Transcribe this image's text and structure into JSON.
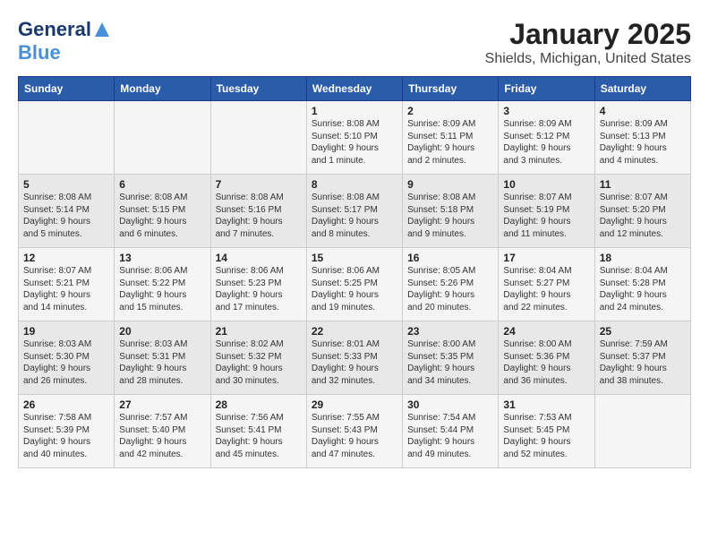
{
  "logo": {
    "general": "General",
    "blue": "Blue"
  },
  "title": "January 2025",
  "subtitle": "Shields, Michigan, United States",
  "weekdays": [
    "Sunday",
    "Monday",
    "Tuesday",
    "Wednesday",
    "Thursday",
    "Friday",
    "Saturday"
  ],
  "weeks": [
    [
      {
        "day": "",
        "info": ""
      },
      {
        "day": "",
        "info": ""
      },
      {
        "day": "",
        "info": ""
      },
      {
        "day": "1",
        "info": "Sunrise: 8:08 AM\nSunset: 5:10 PM\nDaylight: 9 hours\nand 1 minute."
      },
      {
        "day": "2",
        "info": "Sunrise: 8:09 AM\nSunset: 5:11 PM\nDaylight: 9 hours\nand 2 minutes."
      },
      {
        "day": "3",
        "info": "Sunrise: 8:09 AM\nSunset: 5:12 PM\nDaylight: 9 hours\nand 3 minutes."
      },
      {
        "day": "4",
        "info": "Sunrise: 8:09 AM\nSunset: 5:13 PM\nDaylight: 9 hours\nand 4 minutes."
      }
    ],
    [
      {
        "day": "5",
        "info": "Sunrise: 8:08 AM\nSunset: 5:14 PM\nDaylight: 9 hours\nand 5 minutes."
      },
      {
        "day": "6",
        "info": "Sunrise: 8:08 AM\nSunset: 5:15 PM\nDaylight: 9 hours\nand 6 minutes."
      },
      {
        "day": "7",
        "info": "Sunrise: 8:08 AM\nSunset: 5:16 PM\nDaylight: 9 hours\nand 7 minutes."
      },
      {
        "day": "8",
        "info": "Sunrise: 8:08 AM\nSunset: 5:17 PM\nDaylight: 9 hours\nand 8 minutes."
      },
      {
        "day": "9",
        "info": "Sunrise: 8:08 AM\nSunset: 5:18 PM\nDaylight: 9 hours\nand 9 minutes."
      },
      {
        "day": "10",
        "info": "Sunrise: 8:07 AM\nSunset: 5:19 PM\nDaylight: 9 hours\nand 11 minutes."
      },
      {
        "day": "11",
        "info": "Sunrise: 8:07 AM\nSunset: 5:20 PM\nDaylight: 9 hours\nand 12 minutes."
      }
    ],
    [
      {
        "day": "12",
        "info": "Sunrise: 8:07 AM\nSunset: 5:21 PM\nDaylight: 9 hours\nand 14 minutes."
      },
      {
        "day": "13",
        "info": "Sunrise: 8:06 AM\nSunset: 5:22 PM\nDaylight: 9 hours\nand 15 minutes."
      },
      {
        "day": "14",
        "info": "Sunrise: 8:06 AM\nSunset: 5:23 PM\nDaylight: 9 hours\nand 17 minutes."
      },
      {
        "day": "15",
        "info": "Sunrise: 8:06 AM\nSunset: 5:25 PM\nDaylight: 9 hours\nand 19 minutes."
      },
      {
        "day": "16",
        "info": "Sunrise: 8:05 AM\nSunset: 5:26 PM\nDaylight: 9 hours\nand 20 minutes."
      },
      {
        "day": "17",
        "info": "Sunrise: 8:04 AM\nSunset: 5:27 PM\nDaylight: 9 hours\nand 22 minutes."
      },
      {
        "day": "18",
        "info": "Sunrise: 8:04 AM\nSunset: 5:28 PM\nDaylight: 9 hours\nand 24 minutes."
      }
    ],
    [
      {
        "day": "19",
        "info": "Sunrise: 8:03 AM\nSunset: 5:30 PM\nDaylight: 9 hours\nand 26 minutes."
      },
      {
        "day": "20",
        "info": "Sunrise: 8:03 AM\nSunset: 5:31 PM\nDaylight: 9 hours\nand 28 minutes."
      },
      {
        "day": "21",
        "info": "Sunrise: 8:02 AM\nSunset: 5:32 PM\nDaylight: 9 hours\nand 30 minutes."
      },
      {
        "day": "22",
        "info": "Sunrise: 8:01 AM\nSunset: 5:33 PM\nDaylight: 9 hours\nand 32 minutes."
      },
      {
        "day": "23",
        "info": "Sunrise: 8:00 AM\nSunset: 5:35 PM\nDaylight: 9 hours\nand 34 minutes."
      },
      {
        "day": "24",
        "info": "Sunrise: 8:00 AM\nSunset: 5:36 PM\nDaylight: 9 hours\nand 36 minutes."
      },
      {
        "day": "25",
        "info": "Sunrise: 7:59 AM\nSunset: 5:37 PM\nDaylight: 9 hours\nand 38 minutes."
      }
    ],
    [
      {
        "day": "26",
        "info": "Sunrise: 7:58 AM\nSunset: 5:39 PM\nDaylight: 9 hours\nand 40 minutes."
      },
      {
        "day": "27",
        "info": "Sunrise: 7:57 AM\nSunset: 5:40 PM\nDaylight: 9 hours\nand 42 minutes."
      },
      {
        "day": "28",
        "info": "Sunrise: 7:56 AM\nSunset: 5:41 PM\nDaylight: 9 hours\nand 45 minutes."
      },
      {
        "day": "29",
        "info": "Sunrise: 7:55 AM\nSunset: 5:43 PM\nDaylight: 9 hours\nand 47 minutes."
      },
      {
        "day": "30",
        "info": "Sunrise: 7:54 AM\nSunset: 5:44 PM\nDaylight: 9 hours\nand 49 minutes."
      },
      {
        "day": "31",
        "info": "Sunrise: 7:53 AM\nSunset: 5:45 PM\nDaylight: 9 hours\nand 52 minutes."
      },
      {
        "day": "",
        "info": ""
      }
    ]
  ]
}
